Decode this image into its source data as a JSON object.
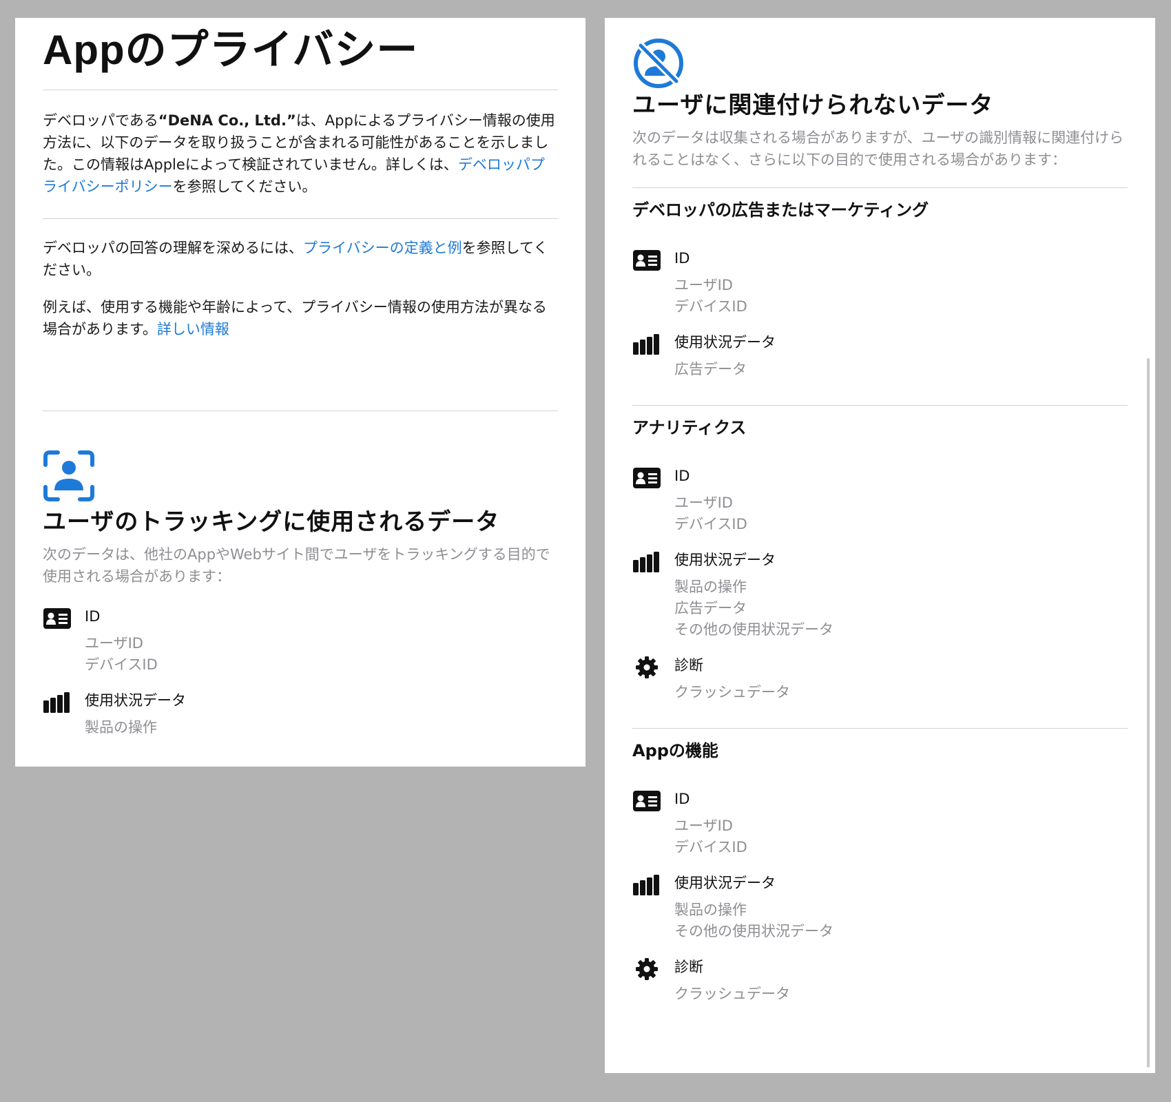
{
  "page_title": "Appのプライバシー",
  "intro": {
    "part1": "デベロッパである",
    "developer": "“DeNA Co., Ltd.”",
    "part2": "は、Appによるプライバシー情報の使用方法に、以下のデータを取り扱うことが含まれる可能性があることを示しました。この情報はAppleによって検証されていません。詳しくは、",
    "policy_link": "デベロッパプライバシーポリシー",
    "part3": "を参照してください。"
  },
  "understand": {
    "part1": "デベロッパの回答の理解を深めるには、",
    "link": "プライバシーの定義と例",
    "part2": "を参照してください。"
  },
  "example": {
    "text": "例えば、使用する機能や年齢によって、プライバシー情報の使用方法が異なる場合があります。",
    "link": "詳しい情報"
  },
  "tracking": {
    "icon": "person-viewfinder-icon",
    "title": "ユーザのトラッキングに使用されるデータ",
    "description": "次のデータは、他社のAppやWebサイト間でユーザをトラッキングする目的で使用される場合があります：",
    "items": [
      {
        "icon": "id-card-icon",
        "label": "ID",
        "subs": [
          "ユーザID",
          "デバイスID"
        ]
      },
      {
        "icon": "bar-chart-icon",
        "label": "使用状況データ",
        "subs": [
          "製品の操作"
        ]
      }
    ]
  },
  "not_linked": {
    "icon": "person-slash-icon",
    "title": "ユーザに関連付けられないデータ",
    "description": "次のデータは収集される場合がありますが、ユーザの識別情報に関連付けられることはなく、さらに以下の目的で使用される場合があります：",
    "categories": [
      {
        "title": "デベロッパの広告またはマーケティング",
        "items": [
          {
            "icon": "id-card-icon",
            "label": "ID",
            "subs": [
              "ユーザID",
              "デバイスID"
            ]
          },
          {
            "icon": "bar-chart-icon",
            "label": "使用状況データ",
            "subs": [
              "広告データ"
            ]
          }
        ]
      },
      {
        "title": "アナリティクス",
        "items": [
          {
            "icon": "id-card-icon",
            "label": "ID",
            "subs": [
              "ユーザID",
              "デバイスID"
            ]
          },
          {
            "icon": "bar-chart-icon",
            "label": "使用状況データ",
            "subs": [
              "製品の操作",
              "広告データ",
              "その他の使用状況データ"
            ]
          },
          {
            "icon": "gear-icon",
            "label": "診断",
            "subs": [
              "クラッシュデータ"
            ]
          }
        ]
      },
      {
        "title": "Appの機能",
        "items": [
          {
            "icon": "id-card-icon",
            "label": "ID",
            "subs": [
              "ユーザID",
              "デバイスID"
            ]
          },
          {
            "icon": "bar-chart-icon",
            "label": "使用状況データ",
            "subs": [
              "製品の操作",
              "その他の使用状況データ"
            ]
          },
          {
            "icon": "gear-icon",
            "label": "診断",
            "subs": [
              "クラッシュデータ"
            ]
          }
        ]
      }
    ]
  },
  "colors": {
    "accent": "#1d7ad8",
    "secondary_text": "#8e8e93",
    "divider": "#d2d2d2",
    "background": "#b3b3b3"
  }
}
